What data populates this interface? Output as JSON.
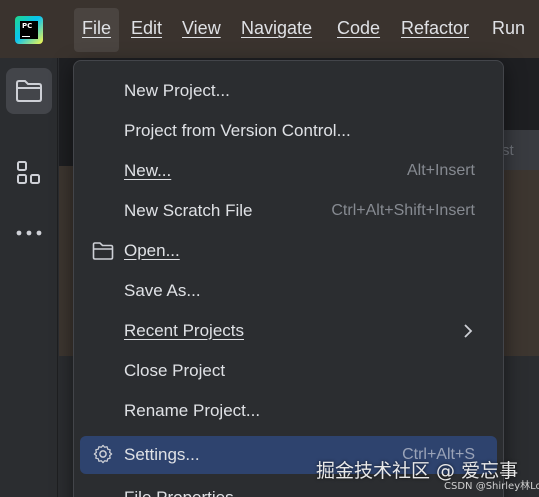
{
  "menubar": {
    "items": [
      {
        "label": "File"
      },
      {
        "label": "Edit"
      },
      {
        "label": "View"
      },
      {
        "label": "Navigate"
      },
      {
        "label": "Code"
      },
      {
        "label": "Refactor"
      },
      {
        "label": "Run"
      }
    ]
  },
  "editor": {
    "hint_text": "st"
  },
  "file_menu": {
    "items": [
      {
        "label": "New Project...",
        "shortcut": ""
      },
      {
        "label": "Project from Version Control...",
        "shortcut": ""
      },
      {
        "label": "New...",
        "shortcut": "Alt+Insert"
      },
      {
        "label": "New Scratch File",
        "shortcut": "Ctrl+Alt+Shift+Insert"
      },
      {
        "label": "Open...",
        "shortcut": "",
        "icon": "folder-icon"
      },
      {
        "label": "Save As...",
        "shortcut": ""
      },
      {
        "label": "Recent Projects",
        "shortcut": "",
        "submenu": true
      },
      {
        "label": "Close Project",
        "shortcut": ""
      },
      {
        "label": "Rename Project...",
        "shortcut": ""
      },
      {
        "label": "Settings...",
        "shortcut": "Ctrl+Alt+S",
        "icon": "gear-icon",
        "highlighted": true
      },
      {
        "label": "File Properties",
        "shortcut": ""
      }
    ]
  },
  "colors": {
    "highlight": "#2e436e",
    "menubar_bg": "#3a332e",
    "text": "#dfe1e5",
    "shortcut_text": "#868a91"
  },
  "watermark": {
    "main": "掘金技术社区 @ 爱忘事",
    "sub": "CSDN @Shirley林Love"
  }
}
